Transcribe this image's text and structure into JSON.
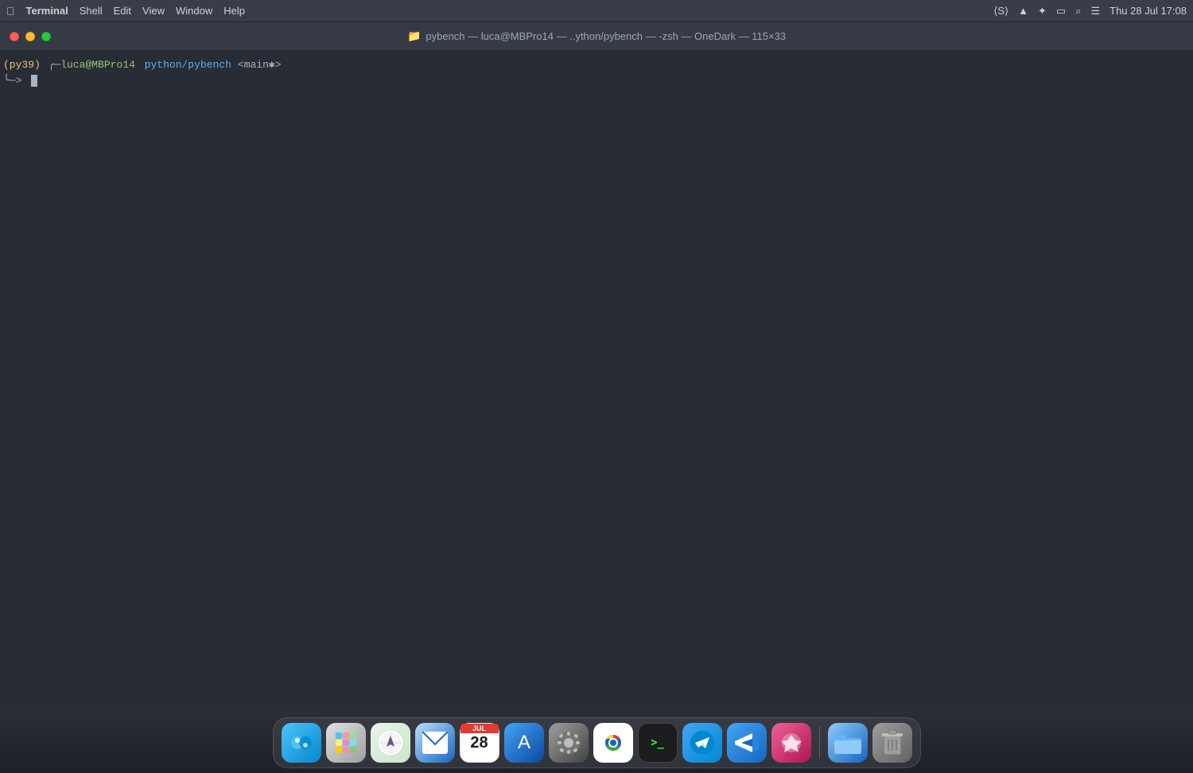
{
  "menubar": {
    "apple_label": "",
    "items": [
      {
        "label": "Terminal",
        "bold": true
      },
      {
        "label": "Shell"
      },
      {
        "label": "Edit"
      },
      {
        "label": "View"
      },
      {
        "label": "Window"
      },
      {
        "label": "Help"
      }
    ],
    "status_icons": [
      "🔊",
      "📶",
      "🔍",
      "📋"
    ],
    "datetime": "Thu 28 Jul  17:08"
  },
  "titlebar": {
    "title": "pybench — luca@MBPro14 — ..ython/pybench — -zsh — OneDark — 115×33",
    "icon": "📁"
  },
  "terminal": {
    "env": "(py39)",
    "prompt_arrow": "╭─",
    "user_host": "luca@MBPro14",
    "path": "python/pybench",
    "branch": "<main✱>",
    "continuation": "╰─>"
  },
  "dock": {
    "items": [
      {
        "name": "finder",
        "emoji": "🔵",
        "label": "Finder",
        "class": "dock-finder"
      },
      {
        "name": "launchpad",
        "emoji": "🚀",
        "label": "Launchpad",
        "class": "dock-launchpad"
      },
      {
        "name": "safari",
        "emoji": "🧭",
        "label": "Safari",
        "class": "dock-safari"
      },
      {
        "name": "mail",
        "emoji": "✉️",
        "label": "Mail",
        "class": "dock-mail"
      },
      {
        "name": "calendar",
        "emoji": "28",
        "label": "Calendar",
        "class": "dock-calendar"
      },
      {
        "name": "appstore",
        "emoji": "🅰",
        "label": "App Store",
        "class": "dock-appstore"
      },
      {
        "name": "preferences",
        "emoji": "⚙️",
        "label": "System Preferences",
        "class": "dock-preferences"
      },
      {
        "name": "chrome",
        "emoji": "🌐",
        "label": "Chrome",
        "class": "dock-chrome"
      },
      {
        "name": "terminal",
        "emoji": ">_",
        "label": "Terminal",
        "class": "dock-terminal"
      },
      {
        "name": "telegram",
        "emoji": "✈",
        "label": "Telegram",
        "class": "dock-telegram"
      },
      {
        "name": "vscode",
        "emoji": "⌨",
        "label": "VS Code",
        "class": "dock-vscode"
      },
      {
        "name": "custom",
        "emoji": "◈",
        "label": "Custom App",
        "class": "dock-custom"
      },
      {
        "name": "folder",
        "emoji": "📂",
        "label": "Folder",
        "class": "dock-folder"
      },
      {
        "name": "trash",
        "emoji": "🗑",
        "label": "Trash",
        "class": "dock-trash"
      }
    ]
  }
}
